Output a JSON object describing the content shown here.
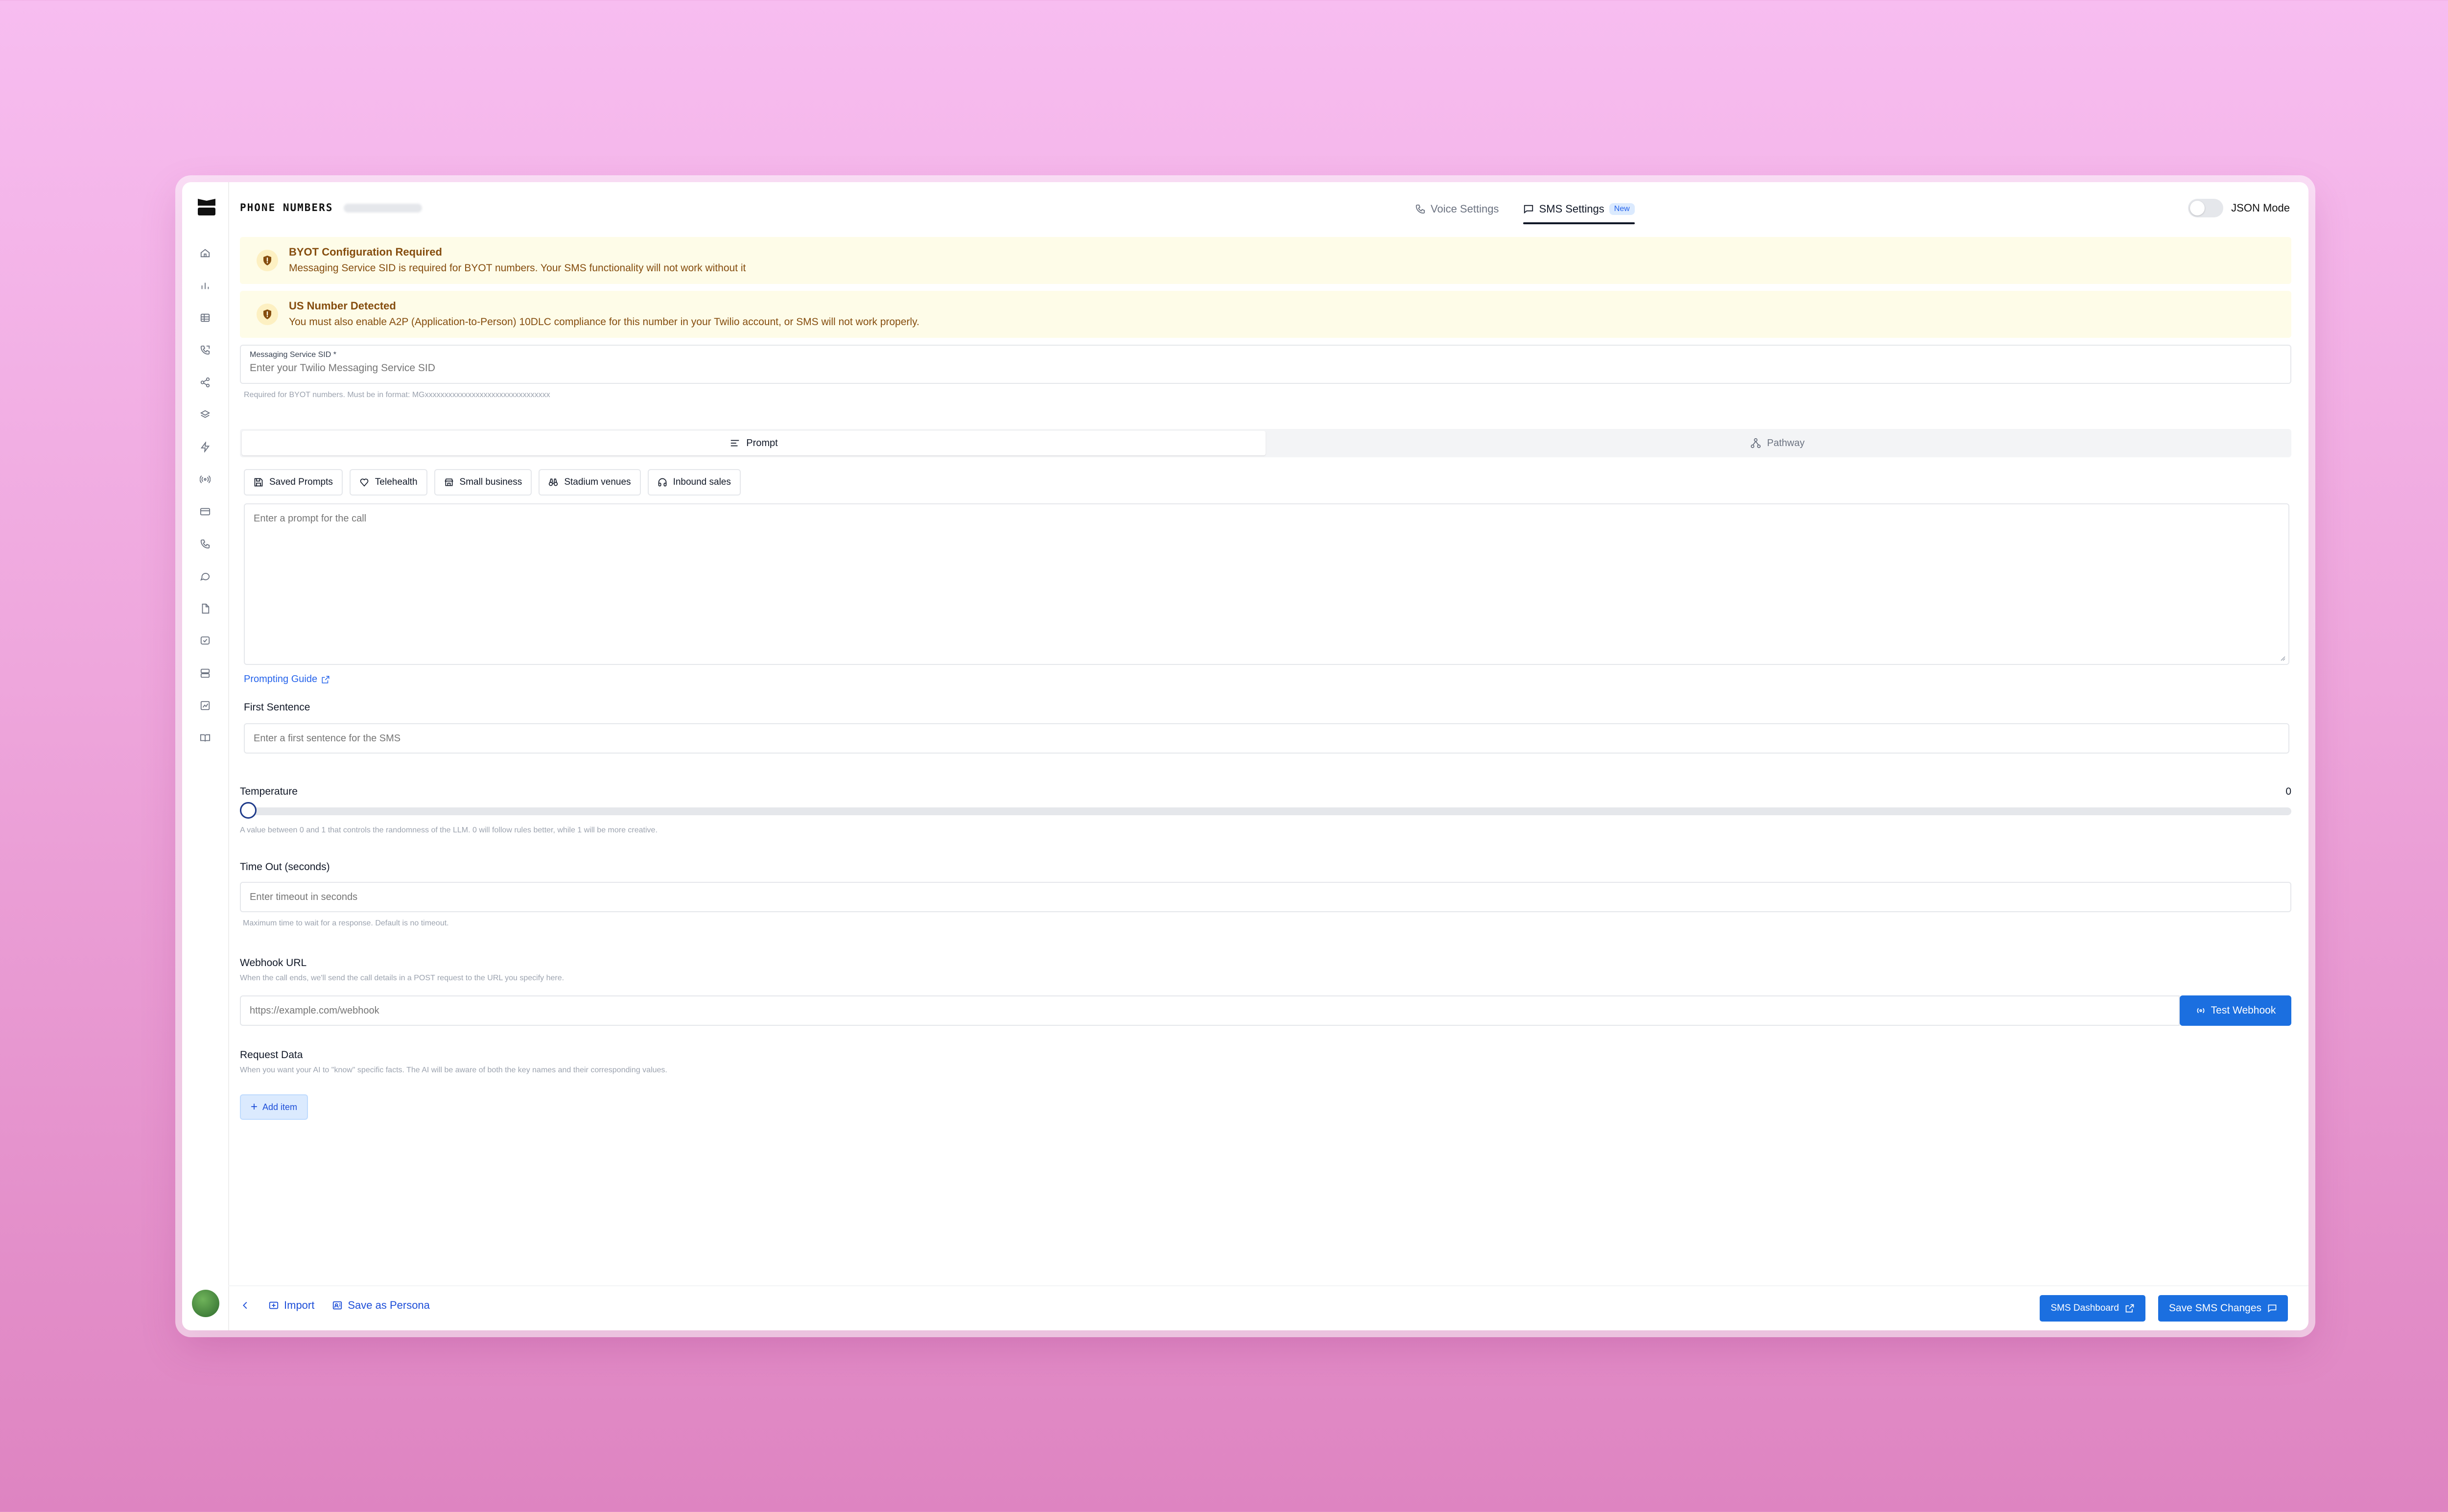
{
  "header": {
    "title": "PHONE NUMBERS",
    "tabs": [
      {
        "label": "Voice Settings",
        "icon": "phone-icon"
      },
      {
        "label": "SMS Settings",
        "icon": "message-square-icon",
        "badge": "New",
        "active": true
      }
    ],
    "json_mode_label": "JSON Mode",
    "json_mode_on": false
  },
  "sidebar": {
    "icons": [
      "home-icon",
      "bar-chart-icon",
      "table-icon",
      "phone-call-icon",
      "share-icon",
      "layers-icon",
      "zap-icon",
      "radio-icon",
      "credit-card-icon",
      "phone-forward-icon",
      "message-circle-icon",
      "file-icon",
      "chat-check-icon",
      "server-icon",
      "graph-icon",
      "book-icon"
    ]
  },
  "alerts": [
    {
      "title": "BYOT Configuration Required",
      "text": "Messaging Service SID is required for BYOT numbers. Your SMS functionality will not work without it"
    },
    {
      "title": "US Number Detected",
      "text": "You must also enable A2P (Application-to-Person) 10DLC compliance for this number in your Twilio account, or SMS will not work properly."
    }
  ],
  "messaging_sid": {
    "label": "Messaging Service SID *",
    "placeholder": "Enter your Twilio Messaging Service SID",
    "helper": "Required for BYOT numbers. Must be in format: MGxxxxxxxxxxxxxxxxxxxxxxxxxxxxxxxx"
  },
  "mode_tabs": [
    {
      "label": "Prompt",
      "active": true
    },
    {
      "label": "Pathway",
      "active": false
    }
  ],
  "prompt_chips": [
    {
      "label": "Saved Prompts",
      "icon": "save-icon"
    },
    {
      "label": "Telehealth",
      "icon": "heart-icon"
    },
    {
      "label": "Small business",
      "icon": "store-icon"
    },
    {
      "label": "Stadium venues",
      "icon": "binoculars-icon"
    },
    {
      "label": "Inbound sales",
      "icon": "headphones-icon"
    }
  ],
  "prompt": {
    "placeholder": "Enter a prompt for the call",
    "guide_label": "Prompting Guide"
  },
  "first_sentence": {
    "label": "First Sentence",
    "placeholder": "Enter a first sentence for the SMS"
  },
  "temperature": {
    "label": "Temperature",
    "value": "0",
    "value_fraction": 0,
    "helper": "A value between 0 and 1 that controls the randomness of the LLM. 0 will follow rules better, while 1 will be more creative."
  },
  "timeout": {
    "label": "Time Out (seconds)",
    "placeholder": "Enter timeout in seconds",
    "helper": "Maximum time to wait for a response. Default is no timeout."
  },
  "webhook": {
    "label": "Webhook URL",
    "helper": "When the call ends, we'll send the call details in a POST request to the URL you specify here.",
    "placeholder": "https://example.com/webhook",
    "test_button": "Test Webhook"
  },
  "request_data": {
    "label": "Request Data",
    "helper": "When you want your AI to \"know\" specific facts. The AI will be aware of both the key names and their corresponding values.",
    "add_button": "Add item"
  },
  "footer": {
    "import_label": "Import",
    "persona_label": "Save as Persona",
    "dashboard_button": "SMS Dashboard",
    "save_button": "Save SMS Changes"
  },
  "colors": {
    "accent": "#1b6fe0",
    "alert_bg": "#fefce8",
    "alert_text": "#854d0e"
  }
}
